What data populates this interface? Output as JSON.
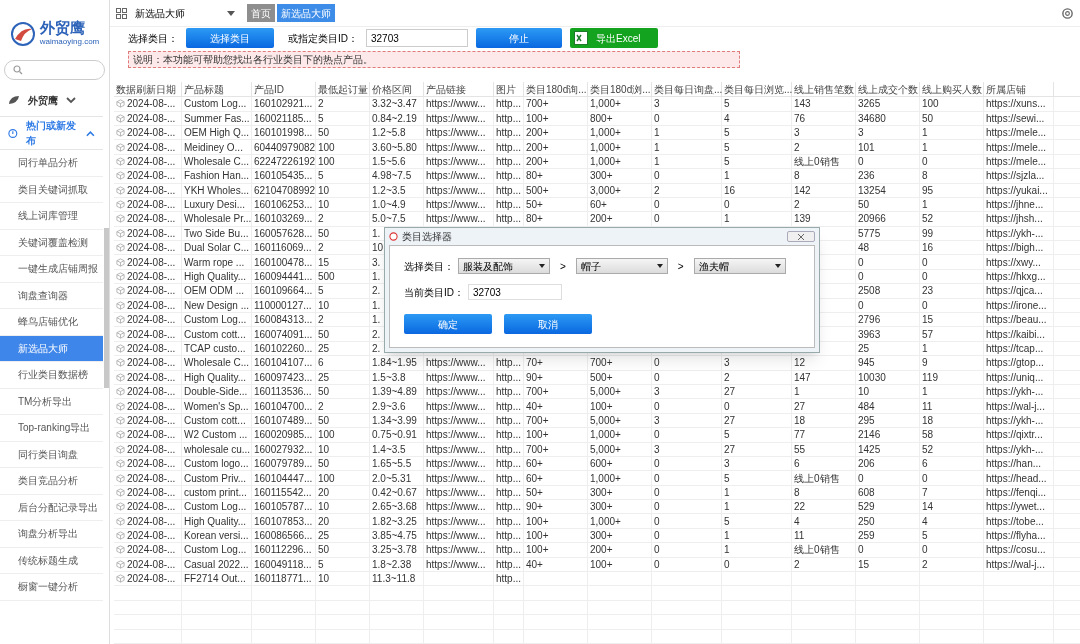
{
  "logo": {
    "name": "外贸鹰",
    "domain": "waimaoying.com"
  },
  "sidebar": {
    "groups": [
      {
        "label": "外贸鹰",
        "expanded": false
      },
      {
        "label": "热门或新发布",
        "expanded": true,
        "items": [
          {
            "label": "同行单品分析",
            "selected": false
          },
          {
            "label": "类目关键词抓取",
            "selected": false
          },
          {
            "label": "线上词库管理",
            "selected": false
          },
          {
            "label": "关键词覆盖检测",
            "selected": false
          },
          {
            "label": "一键生成店铺周报",
            "selected": false
          },
          {
            "label": "询盘查询器",
            "selected": false
          },
          {
            "label": "蜂鸟店铺优化",
            "selected": false
          },
          {
            "label": "新选品大师",
            "selected": true
          },
          {
            "label": "行业类目数据榜",
            "selected": false
          },
          {
            "label": "TM分析导出",
            "selected": false
          },
          {
            "label": "Top-ranking导出",
            "selected": false
          },
          {
            "label": "同行类目询盘",
            "selected": false
          },
          {
            "label": "类目竞品分析",
            "selected": false
          },
          {
            "label": "后台分配记录导出",
            "selected": false
          },
          {
            "label": "询盘分析导出",
            "selected": false
          },
          {
            "label": "传统标题生成",
            "selected": false
          },
          {
            "label": "橱窗一键分析",
            "selected": false
          }
        ]
      }
    ]
  },
  "topbar": {
    "module_select": "新选品大师",
    "tabs": [
      {
        "label": "首页",
        "selected": false
      },
      {
        "label": "新选品大师",
        "selected": true
      }
    ]
  },
  "toolbar": {
    "category_label": "选择类目：",
    "category_button": "选择类目",
    "id_label": "或指定类目ID：",
    "id_value": "32703",
    "stop_button": "停止",
    "export_button": "导出Excel"
  },
  "notice": "说明：本功能可帮助您找出各行业类目下的热点产品。",
  "table": {
    "columns": [
      "数据刷新日期",
      "产品标题",
      "产品ID",
      "最低起订量",
      "价格区间",
      "产品链接",
      "图片",
      "类目180d询...",
      "类目180d浏...",
      "类目每日询盘...",
      "类目每日浏览...",
      "线上销售笔数",
      "线上成交个数",
      "线上购买人数",
      "所属店铺"
    ],
    "rows": [
      {
        "cells": [
          "2024-08-...",
          "Custom Log...",
          "160102921...",
          "2",
          "3.32~3.47",
          "https://www...",
          "http...",
          "700+",
          "1,000+",
          "3",
          "5",
          "143",
          "3265",
          "100",
          "https://xuns..."
        ]
      },
      {
        "cells": [
          "2024-08-...",
          "Summer Fas...",
          "160021185...",
          "5",
          "0.84~2.19",
          "https://www...",
          "http...",
          "100+",
          "800+",
          "0",
          "4",
          "76",
          "34680",
          "50",
          "https://sewi..."
        ]
      },
      {
        "cells": [
          "2024-08-...",
          "OEM High Q...",
          "160101998...",
          "50",
          "1.2~5.8",
          "https://www...",
          "http...",
          "200+",
          "1,000+",
          "1",
          "5",
          "3",
          "3",
          "1",
          "https://mele..."
        ]
      },
      {
        "cells": [
          "2024-08-...",
          "Meidiney O...",
          "60440979082",
          "100",
          "3.60~5.80",
          "https://www...",
          "http...",
          "200+",
          "1,000+",
          "1",
          "5",
          "2",
          "101",
          "1",
          "https://mele..."
        ]
      },
      {
        "cells": [
          "2024-08-...",
          "Wholesale C...",
          "62247226192",
          "100",
          "1.5~5.6",
          "https://www...",
          "http...",
          "200+",
          "1,000+",
          "1",
          "5",
          "线上0销售",
          "0",
          "0",
          "https://mele..."
        ]
      },
      {
        "cells": [
          "2024-08-...",
          "Fashion Han...",
          "160105435...",
          "5",
          "4.98~7.5",
          "https://www...",
          "http...",
          "80+",
          "300+",
          "0",
          "1",
          "8",
          "236",
          "8",
          "https://sjzla..."
        ]
      },
      {
        "cells": [
          "2024-08-...",
          "YKH Wholes...",
          "62104708992",
          "10",
          "1.2~3.5",
          "https://www...",
          "http...",
          "500+",
          "3,000+",
          "2",
          "16",
          "142",
          "13254",
          "95",
          "https://yukai..."
        ]
      },
      {
        "cells": [
          "2024-08-...",
          "Luxury Desi...",
          "160106253...",
          "10",
          "1.0~4.9",
          "https://www...",
          "http...",
          "50+",
          "60+",
          "0",
          "0",
          "2",
          "50",
          "1",
          "https://jhne..."
        ]
      },
      {
        "cells": [
          "2024-08-...",
          "Wholesale Pr...",
          "160103269...",
          "2",
          "5.0~7.5",
          "https://www...",
          "http...",
          "80+",
          "200+",
          "0",
          "1",
          "139",
          "20966",
          "52",
          "https://jhsh..."
        ]
      },
      {
        "cells": [
          "2024-08-...",
          "Two Side Bu...",
          "160057628...",
          "50",
          "1.",
          null,
          null,
          null,
          null,
          null,
          null,
          null,
          "5775",
          "99",
          "https://ykh-..."
        ]
      },
      {
        "cells": [
          "2024-08-...",
          "Dual Solar C...",
          "160116069...",
          "2",
          "10",
          null,
          null,
          null,
          null,
          null,
          null,
          null,
          "48",
          "16",
          "https://bigh..."
        ]
      },
      {
        "cells": [
          "2024-08-...",
          "Warm rope ...",
          "160100478...",
          "15",
          "3.",
          null,
          null,
          null,
          null,
          null,
          null,
          null,
          "0",
          "0",
          "https://xwy..."
        ]
      },
      {
        "cells": [
          "2024-08-...",
          "High Quality...",
          "160094441...",
          "500",
          "1.",
          null,
          null,
          null,
          null,
          null,
          null,
          null,
          "0",
          "0",
          "https://hkxg..."
        ]
      },
      {
        "cells": [
          "2024-08-...",
          "OEM ODM ...",
          "160109664...",
          "5",
          "2.",
          null,
          null,
          null,
          null,
          null,
          null,
          null,
          "2508",
          "23",
          "https://qjca..."
        ]
      },
      {
        "cells": [
          "2024-08-...",
          "New Design ...",
          "110000127...",
          "10",
          "1.",
          null,
          null,
          null,
          null,
          null,
          null,
          null,
          "0",
          "0",
          "https://irone..."
        ]
      },
      {
        "cells": [
          "2024-08-...",
          "Custom Log...",
          "160084313...",
          "2",
          "1.",
          null,
          null,
          null,
          null,
          null,
          null,
          null,
          "2796",
          "15",
          "https://beau..."
        ]
      },
      {
        "cells": [
          "2024-08-...",
          "Custom cott...",
          "160074091...",
          "50",
          "2.",
          null,
          null,
          null,
          null,
          null,
          null,
          null,
          "3963",
          "57",
          "https://kaibi..."
        ]
      },
      {
        "cells": [
          "2024-08-...",
          "TCAP custo...",
          "160102260...",
          "25",
          "2.",
          null,
          null,
          null,
          null,
          null,
          null,
          null,
          "25",
          "1",
          "https://tcap..."
        ]
      },
      {
        "cells": [
          "2024-08-...",
          "Wholesale C...",
          "160104107...",
          "6",
          "1.84~1.95",
          "https://www...",
          "http...",
          "70+",
          "700+",
          "0",
          "3",
          "12",
          "945",
          "9",
          "https://gtop..."
        ]
      },
      {
        "cells": [
          "2024-08-...",
          "High Quality...",
          "160097423...",
          "25",
          "1.5~3.8",
          "https://www...",
          "http...",
          "90+",
          "500+",
          "0",
          "2",
          "147",
          "10030",
          "119",
          "https://uniq..."
        ]
      },
      {
        "cells": [
          "2024-08-...",
          "Double-Side...",
          "160113536...",
          "50",
          "1.39~4.89",
          "https://www...",
          "http...",
          "700+",
          "5,000+",
          "3",
          "27",
          "1",
          "10",
          "1",
          "https://ykh-..."
        ]
      },
      {
        "cells": [
          "2024-08-...",
          "Women's Sp...",
          "160104700...",
          "2",
          "2.9~3.6",
          "https://www...",
          "http...",
          "40+",
          "100+",
          "0",
          "0",
          "27",
          "484",
          "11",
          "https://wal-j..."
        ]
      },
      {
        "cells": [
          "2024-08-...",
          "Custom cott...",
          "160107489...",
          "50",
          "1.34~3.99",
          "https://www...",
          "http...",
          "700+",
          "5,000+",
          "3",
          "27",
          "18",
          "295",
          "18",
          "https://ykh-..."
        ]
      },
      {
        "cells": [
          "2024-08-...",
          "W2 Custom ...",
          "160020985...",
          "100",
          "0.75~0.91",
          "https://www...",
          "http...",
          "100+",
          "1,000+",
          "0",
          "5",
          "77",
          "2146",
          "58",
          "https://qixtr..."
        ]
      },
      {
        "cells": [
          "2024-08-...",
          "wholesale cu...",
          "160027932...",
          "10",
          "1.4~3.5",
          "https://www...",
          "http...",
          "700+",
          "5,000+",
          "3",
          "27",
          "55",
          "1425",
          "52",
          "https://ykh-..."
        ]
      },
      {
        "cells": [
          "2024-08-...",
          "Custom logo...",
          "160079789...",
          "50",
          "1.65~5.5",
          "https://www...",
          "http...",
          "60+",
          "600+",
          "0",
          "3",
          "6",
          "206",
          "6",
          "https://han..."
        ]
      },
      {
        "cells": [
          "2024-08-...",
          "Custom Priv...",
          "160104447...",
          "100",
          "2.0~5.31",
          "https://www...",
          "http...",
          "60+",
          "1,000+",
          "0",
          "5",
          "线上0销售",
          "0",
          "0",
          "https://head..."
        ]
      },
      {
        "cells": [
          "2024-08-...",
          "custom print...",
          "160115542...",
          "20",
          "0.42~0.67",
          "https://www...",
          "http...",
          "50+",
          "300+",
          "0",
          "1",
          "8",
          "608",
          "7",
          "https://fenqi..."
        ]
      },
      {
        "cells": [
          "2024-08-...",
          "Custom Log...",
          "160105787...",
          "10",
          "2.65~3.68",
          "https://www...",
          "http...",
          "90+",
          "300+",
          "0",
          "1",
          "22",
          "529",
          "14",
          "https://ywet..."
        ]
      },
      {
        "cells": [
          "2024-08-...",
          "High Quality...",
          "160107853...",
          "20",
          "1.82~3.25",
          "https://www...",
          "http...",
          "100+",
          "1,000+",
          "0",
          "5",
          "4",
          "250",
          "4",
          "https://tobe..."
        ]
      },
      {
        "cells": [
          "2024-08-...",
          "Korean versi...",
          "160086566...",
          "25",
          "3.85~4.75",
          "https://www...",
          "http...",
          "100+",
          "300+",
          "0",
          "1",
          "11",
          "259",
          "5",
          "https://flyha..."
        ]
      },
      {
        "cells": [
          "2024-08-...",
          "Custom Log...",
          "160112296...",
          "50",
          "3.25~3.78",
          "https://www...",
          "http...",
          "100+",
          "200+",
          "0",
          "1",
          "线上0销售",
          "0",
          "0",
          "https://cosu..."
        ]
      },
      {
        "cells": [
          "2024-08-...",
          "Casual 2022...",
          "160049118...",
          "5",
          "1.8~2.38",
          "https://www...",
          "http...",
          "40+",
          "100+",
          "0",
          "0",
          "2",
          "15",
          "2",
          "https://wal-j..."
        ]
      },
      {
        "cells": [
          "2024-08-...",
          "FF2714 Out...",
          "160118771...",
          "10",
          "11.3~11.8",
          null,
          "http...",
          null,
          null,
          null,
          null,
          null,
          null,
          null,
          null
        ]
      }
    ]
  },
  "dialog": {
    "title": "类目选择器",
    "category_label": "选择类目：",
    "selects": [
      "服装及配饰",
      "帽子",
      "渔夫帽"
    ],
    "separators": [
      ">",
      ">"
    ],
    "id_label": "当前类目ID：",
    "id_value": "32703",
    "buttons": [
      "确定",
      "取消"
    ]
  }
}
